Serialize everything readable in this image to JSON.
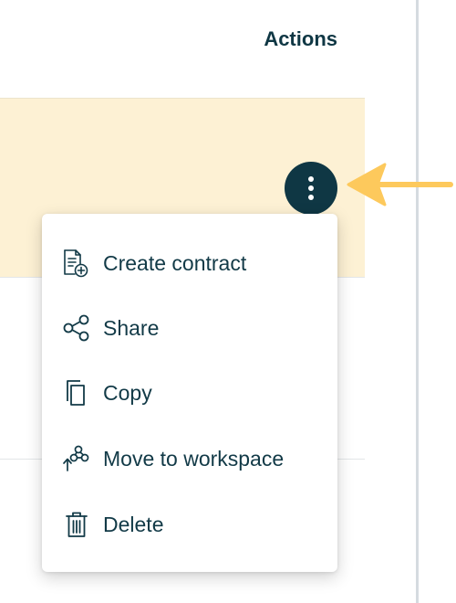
{
  "table": {
    "actions_header": "Actions"
  },
  "menu": {
    "items": [
      {
        "label": "Create contract",
        "icon": "create-contract-icon"
      },
      {
        "label": "Share",
        "icon": "share-icon"
      },
      {
        "label": "Copy",
        "icon": "copy-icon"
      },
      {
        "label": "Move to workspace",
        "icon": "move-to-workspace-icon"
      },
      {
        "label": "Delete",
        "icon": "trash-icon"
      }
    ]
  },
  "colors": {
    "primary": "#0f3744",
    "row_highlight": "#fdf1d4",
    "arrow": "#fdc95c",
    "divider": "#d5dbe0"
  }
}
